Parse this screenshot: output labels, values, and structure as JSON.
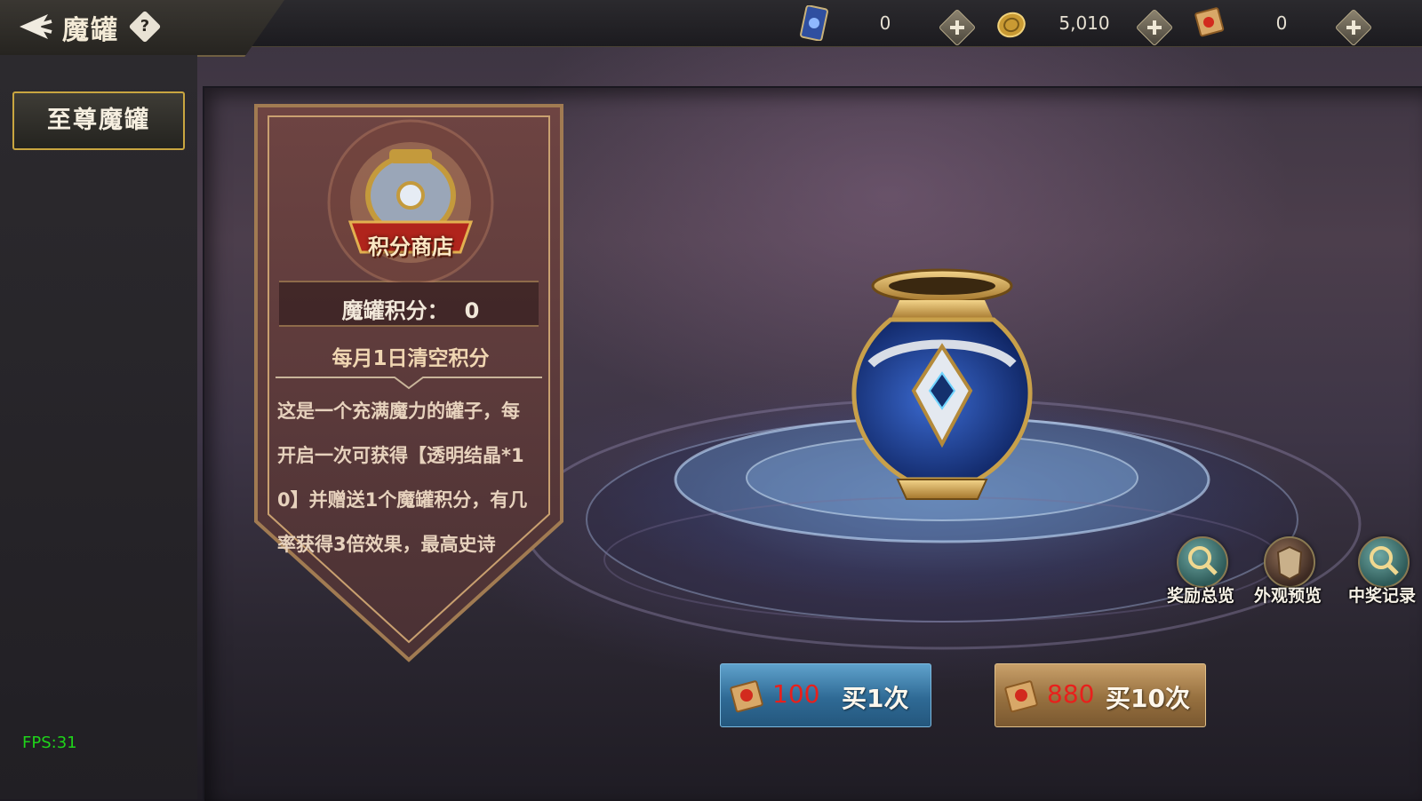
{
  "header": {
    "title": "魔罐",
    "help_glyph": "?"
  },
  "resources": [
    {
      "icon": "card-ticket-icon",
      "value": "0"
    },
    {
      "icon": "gold-coin-icon",
      "value": "5,010"
    },
    {
      "icon": "scroll-voucher-icon",
      "value": "0"
    }
  ],
  "sidebar": {
    "tabs": [
      {
        "label": "至尊魔罐",
        "selected": true
      }
    ]
  },
  "shop_banner": {
    "emblem_label": "积分商店",
    "points_label": "魔罐积分：",
    "points_value": "0",
    "reset_note": "每月1日清空积分",
    "description_lines": [
      "这是一个充满魔力的罐子，每",
      "开启一次可获得【透明结晶*1",
      "0】并赠送1个魔罐积分，有几",
      "率获得3倍效果，最高史诗"
    ]
  },
  "side_buttons": [
    {
      "label": "奖励总览",
      "icon": "magnifier-icon"
    },
    {
      "label": "外观预览",
      "icon": "armor-preview-icon"
    },
    {
      "label": "中奖记录",
      "icon": "magnifier-icon"
    }
  ],
  "buy_buttons": [
    {
      "price": "100",
      "label": "买1次",
      "color": "#3b7fae"
    },
    {
      "price": "880",
      "label": "买10次",
      "color": "#a27a48"
    }
  ],
  "fps": "FPS:31",
  "colors": {
    "accent_gold": "#c9a640",
    "price_red": "#e8201c",
    "fps_green": "#1fd41a"
  }
}
